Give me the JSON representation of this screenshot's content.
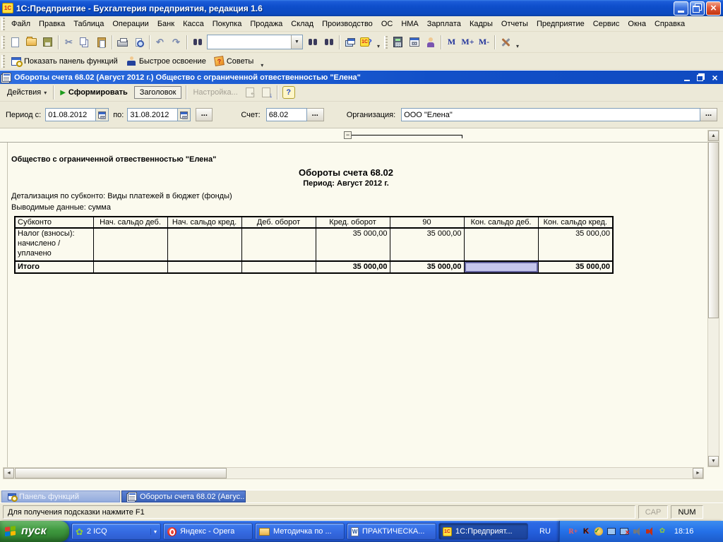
{
  "window": {
    "title": "1С:Предприятие  - Бухгалтерия предприятия, редакция 1.6"
  },
  "icons": {
    "one_c": "1С",
    "cut": "✂",
    "undo": "↶",
    "redo": "↷",
    "combo_arrow": "▼",
    "more": "▾",
    "run": "▶",
    "help_q": "?",
    "m": "M",
    "m_plus": "M+",
    "m_minus": "M-",
    "collapse": "−"
  },
  "menubar": {
    "items": [
      "Файл",
      "Правка",
      "Таблица",
      "Операции",
      "Банк",
      "Касса",
      "Покупка",
      "Продажа",
      "Склад",
      "Производство",
      "ОС",
      "НМА",
      "Зарплата",
      "Кадры",
      "Отчеты",
      "Предприятие",
      "Сервис",
      "Окна",
      "Справка"
    ]
  },
  "toolbar1": {
    "search_value": ""
  },
  "toolbar2": {
    "show_panel": "Показать панель функций",
    "quick": "Быстрое освоение",
    "tips": "Советы"
  },
  "doc": {
    "title": "Обороты счета 68.02 (Август 2012 г.) Общество с ограниченной отвественностью \"Елена\"",
    "toolbar": {
      "actions": "Действия",
      "generate": "Сформировать",
      "header_btn": "Заголовок",
      "settings": "Настройка..."
    },
    "params": {
      "period_from_label": "Период с:",
      "period_from": "01.08.2012",
      "period_to_label": "по:",
      "period_to": "31.08.2012",
      "account_label": "Счет:",
      "account": "68.02",
      "org_label": "Организация:",
      "org": "ООО \"Елена\"",
      "dots": "..."
    }
  },
  "report": {
    "org_line": "Общество с ограниченной отвественностью \"Елена\"",
    "title": "Обороты счета 68.02",
    "period": "Период: Август 2012 г.",
    "detail_line": "Детализация по субконто: Виды платежей в бюджет (фонды)",
    "data_line": "Выводимые данные: сумма",
    "table": {
      "headers": [
        "Субконто",
        "Нач. сальдо деб.",
        "Нач. сальдо кред.",
        "Деб. оборот",
        "Кред. оборот",
        "90",
        "Кон. сальдо деб.",
        "Кон. сальдо кред."
      ],
      "rows": [
        {
          "cells": [
            "Налог (взносы): начислено / уплачено",
            "",
            "",
            "",
            "35 000,00",
            "35 000,00",
            "",
            "35 000,00"
          ]
        },
        {
          "cells": [
            "Итого",
            "",
            "",
            "",
            "35 000,00",
            "35 000,00",
            "",
            "35 000,00"
          ]
        }
      ]
    }
  },
  "mdi_tabs": [
    {
      "label": "Панель функций"
    },
    {
      "label": "Обороты счета 68.02 (Авгус..."
    }
  ],
  "statusbar": {
    "hint": "Для получения подсказки нажмите F1",
    "cap": "CAP",
    "num": "NUM"
  },
  "taskbar": {
    "start": "пуск",
    "buttons": [
      "2 ICQ",
      "Яндекс - Opera",
      "Методичка по ...",
      "ПРАКТИЧЕСКА...",
      "1С:Предприят..."
    ],
    "lang": "RU",
    "time": "18:16"
  }
}
